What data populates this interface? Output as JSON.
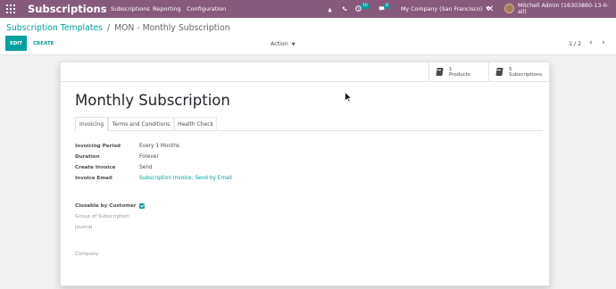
{
  "navbar": {
    "brand": "Subscriptions",
    "menu": [
      "Subscriptions",
      "Reporting",
      "Configuration"
    ],
    "messages_count": "10",
    "activities_count": "8",
    "company": "My Company (San Francisco)",
    "user": "Mitchell Admin (16303860-13-0-all)"
  },
  "control_panel": {
    "breadcrumb_parent": "Subscription Templates",
    "breadcrumb_separator": "/",
    "breadcrumb_current": "MON - Monthly Subscription",
    "edit_label": "EDIT",
    "create_label": "CREATE",
    "action_label": "Action",
    "pager": "1 / 2"
  },
  "form": {
    "stat_buttons": [
      {
        "value": "1",
        "label": "Products"
      },
      {
        "value": "5",
        "label": "Subscriptions"
      }
    ],
    "title": "Monthly Subscription",
    "tabs": [
      "Invoicing",
      "Terms and Conditions",
      "Health Check"
    ],
    "fields": {
      "invoicing_period_label": "Invoicing Period",
      "invoicing_period_value": "Every 1 Months",
      "duration_label": "Duration",
      "duration_value": "Forever",
      "create_invoice_label": "Create Invoice",
      "create_invoice_value": "Send",
      "invoice_email_label": "Invoice Email",
      "invoice_email_value": "Subscription Invoice: Send by Email",
      "closable_label": "Closable by Customer",
      "closable_checked": true,
      "group_label": "Group of Subscription",
      "journal_label": "Journal",
      "company_label": "Company"
    }
  },
  "colors": {
    "navbar": "#875a7b",
    "accent": "#00a09d",
    "background": "#f2f2f2"
  }
}
